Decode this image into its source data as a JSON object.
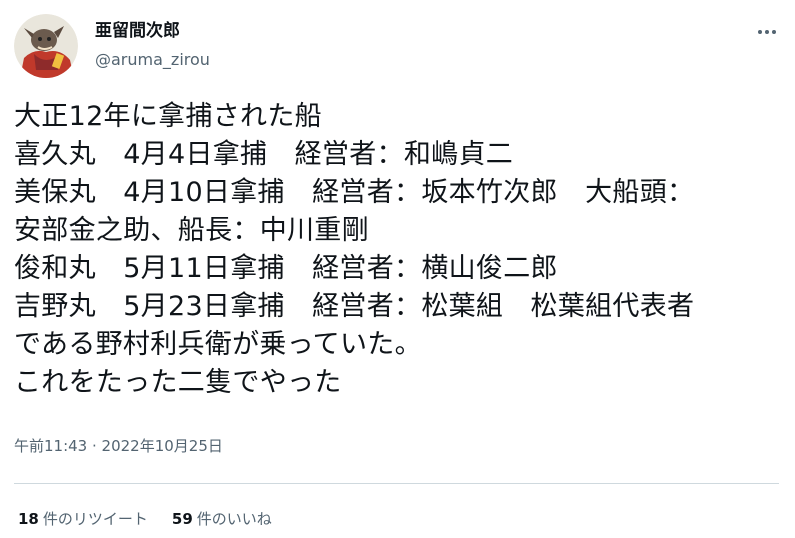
{
  "user": {
    "display_name": "亜留間次郎",
    "handle": "@aruma_zirou",
    "avatar_icon": "avatar-character-icon"
  },
  "more_icon": "more-options-icon",
  "tweet": {
    "lines": [
      "大正12年に拿捕された船",
      "喜久丸　4月4日拿捕　経営者：和嶋貞二",
      "美保丸　4月10日拿捕　経営者：坂本竹次郎　大船頭：",
      "安部金之助、船長：中川重剛",
      "俊和丸　5月11日拿捕　経営者：横山俊二郎",
      "吉野丸　5月23日拿捕　経営者：松葉組　松葉組代表者",
      "である野村利兵衛が乗っていた。",
      "これをたった二隻でやった"
    ]
  },
  "meta": {
    "time": "午前11:43",
    "separator": " · ",
    "date": "2022年10月25日"
  },
  "stats": {
    "retweets_count": "18",
    "retweets_label": "件のリツイート",
    "likes_count": "59",
    "likes_label": "件のいいね"
  },
  "colors": {
    "text": "#0f1419",
    "secondary": "#536471",
    "divider": "#cfd9de",
    "avatar_bg": "#e9e6dc",
    "avatar_accent": "#c0392b"
  }
}
